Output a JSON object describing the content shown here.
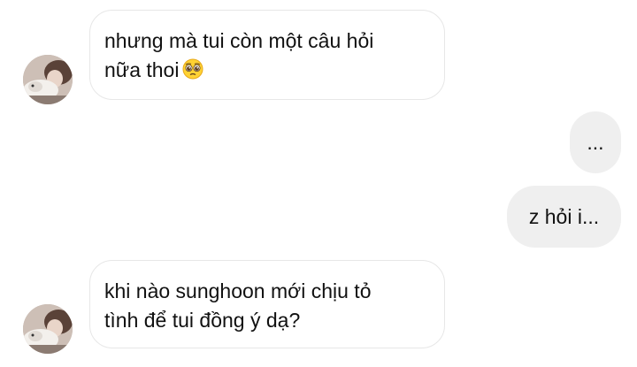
{
  "conversation": {
    "messages": [
      {
        "direction": "incoming",
        "line1": "nhưng mà tui còn một câu hỏi",
        "line2": "nữa thoi",
        "emoji": "pleading-face-icon"
      },
      {
        "direction": "outgoing",
        "text": "..."
      },
      {
        "direction": "outgoing",
        "text": "z hỏi i..."
      },
      {
        "direction": "incoming",
        "line1": "khi nào sunghoon mới chịu tỏ",
        "line2": "tình để tui đồng ý dạ?"
      }
    ]
  },
  "colors": {
    "incoming_bubble_bg": "#ffffff",
    "incoming_bubble_border": "#e7e7e7",
    "outgoing_bubble_bg": "#efefef",
    "text": "#111111"
  }
}
